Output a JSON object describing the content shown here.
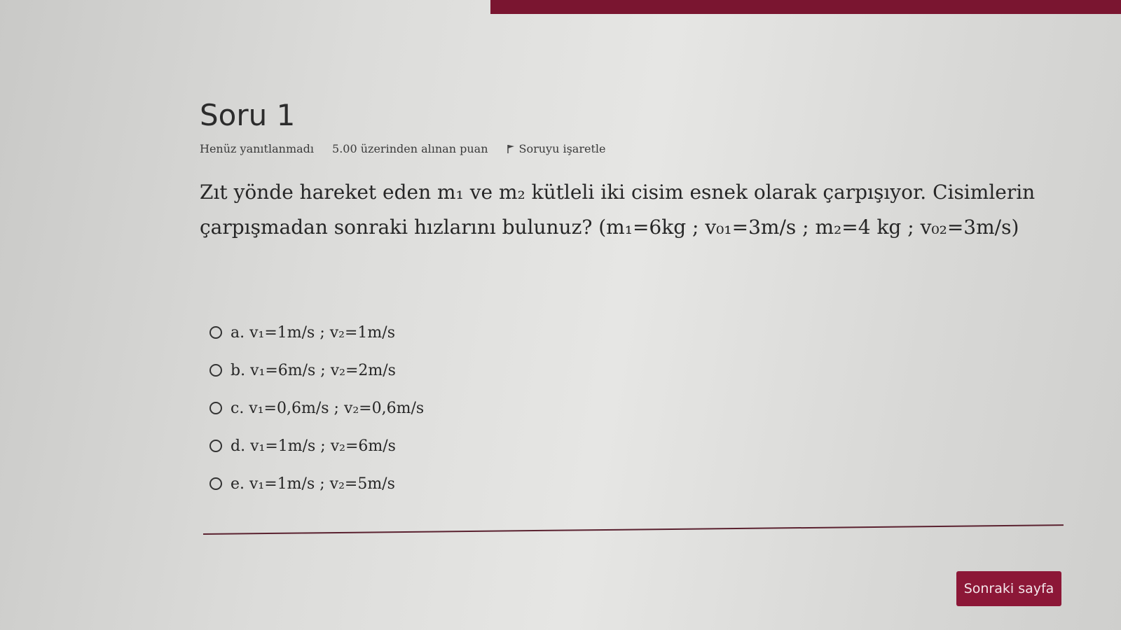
{
  "question": {
    "title": "Soru 1",
    "status": "Henüz yanıtlanmadı",
    "points": "5.00 üzerinden alınan puan",
    "flag_label": "Soruyu işaretle",
    "text_line1": "Zıt yönde hareket eden m₁ ve m₂ kütleli iki cisim esnek olarak çarpışıyor. Cisimlerin",
    "text_line2": "çarpışmadan sonraki hızlarını bulunuz? (m₁=6kg ; v₀₁=3m/s ; m₂=4 kg  ;  v₀₂=3m/s)"
  },
  "answers": [
    {
      "label": "a. v₁=1m/s   ;  v₂=1m/s"
    },
    {
      "label": "b. v₁=6m/s   ; v₂=2m/s"
    },
    {
      "label": "c. v₁=0,6m/s  ; v₂=0,6m/s"
    },
    {
      "label": "d. v₁=1m/s      ;  v₂=6m/s"
    },
    {
      "label": "e. v₁=1m/s  ;   v₂=5m/s"
    }
  ],
  "navigation": {
    "next_label": "Sonraki sayfa"
  },
  "colors": {
    "accent": "#8c1737",
    "top_bar": "#7a1530"
  }
}
